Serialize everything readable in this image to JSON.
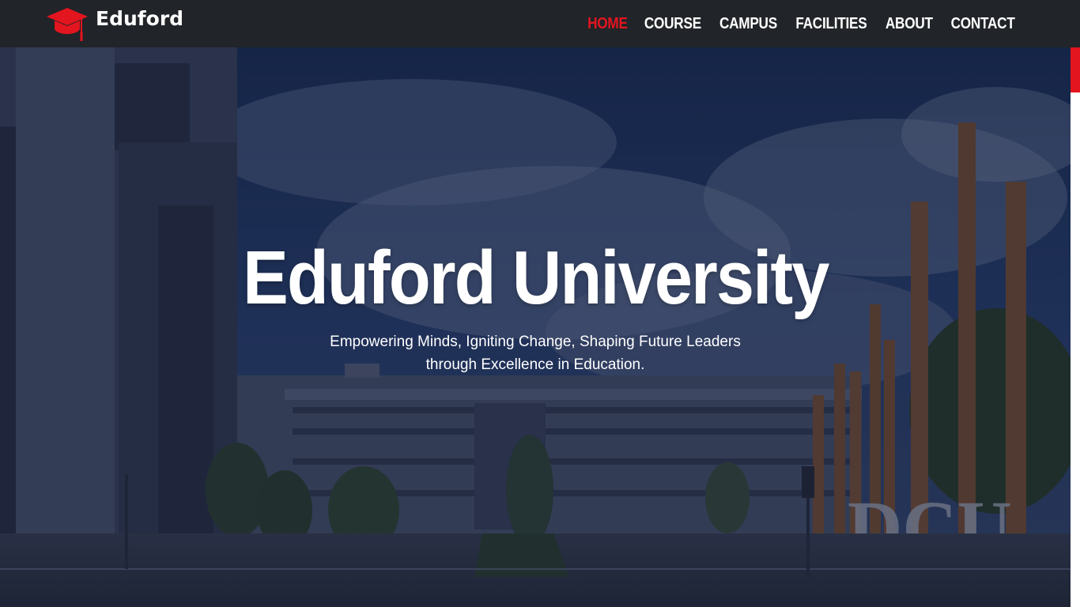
{
  "brand": {
    "name": "Eduford",
    "logo_icon": "graduation-cap-icon",
    "accent_color": "#e3151f"
  },
  "nav": {
    "items": [
      {
        "label": "HOME",
        "active": true
      },
      {
        "label": "COURSE",
        "active": false
      },
      {
        "label": "CAMPUS",
        "active": false
      },
      {
        "label": "FACILITIES",
        "active": false
      },
      {
        "label": "ABOUT",
        "active": false
      },
      {
        "label": "CONTACT",
        "active": false
      }
    ]
  },
  "hero": {
    "title": "Eduford University",
    "subtitle_line1": "Empowering Minds, Igniting Change, Shaping Future Leaders",
    "subtitle_line2": "through Excellence in Education.",
    "background_sign": "DCU"
  },
  "scroll_progress": {
    "fraction": 0.08,
    "color": "#e3151f"
  }
}
